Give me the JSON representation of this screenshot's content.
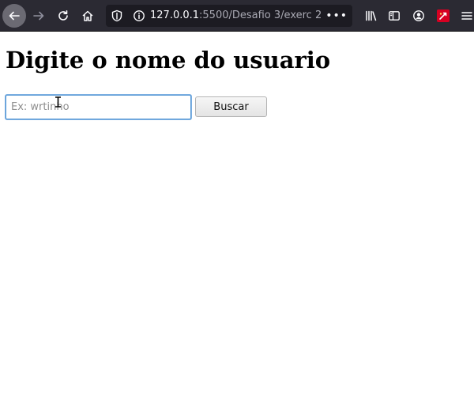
{
  "browser": {
    "url_host": "127.0.0.1",
    "url_path": ":5500/Desafio 3/exerc 2",
    "icons": {
      "back": "arrow-left-icon",
      "forward": "arrow-right-icon",
      "reload": "reload-icon",
      "home": "home-icon",
      "tracking": "shield-icon",
      "site_info": "info-icon",
      "page_actions": "ellipsis-icon",
      "library": "library-icon",
      "sidebar": "sidebar-icon",
      "account": "account-icon",
      "extension": "extension-icon",
      "menu": "hamburger-menu-icon"
    }
  },
  "page": {
    "heading": "Digite o nome do usuario",
    "search": {
      "placeholder": "Ex: wrtinho",
      "value": ""
    },
    "search_button": "Buscar"
  },
  "colors": {
    "toolbar": "#2b2a33",
    "urlbar": "#1c1b22",
    "focus_ring": "#5b9bd5"
  }
}
